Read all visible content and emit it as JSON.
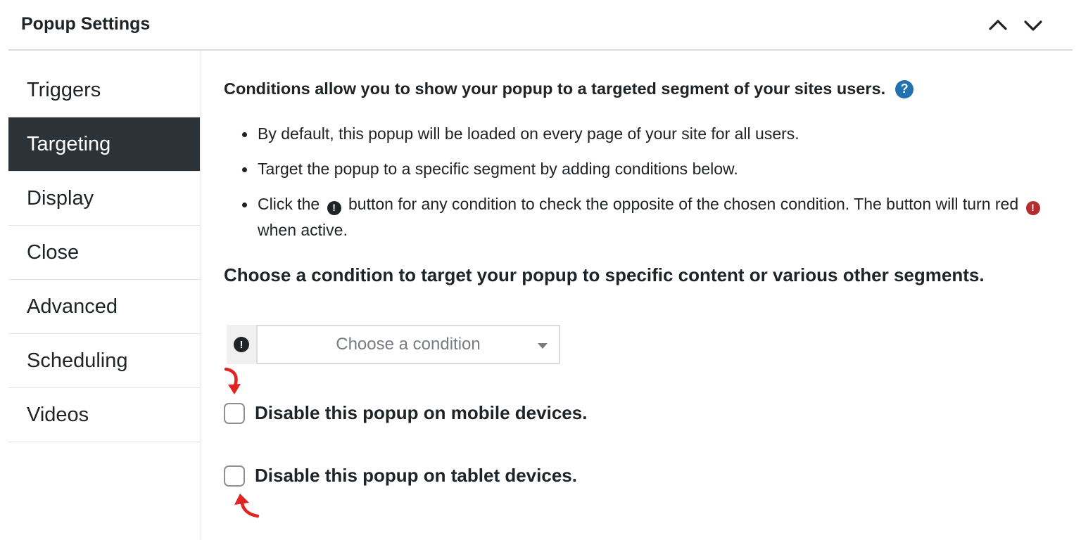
{
  "header": {
    "title": "Popup Settings",
    "up_icon": "chevron-up-icon",
    "down_icon": "chevron-down-icon"
  },
  "tabs": [
    {
      "label": "Triggers",
      "active": false
    },
    {
      "label": "Targeting",
      "active": true
    },
    {
      "label": "Display",
      "active": false
    },
    {
      "label": "Close",
      "active": false
    },
    {
      "label": "Advanced",
      "active": false
    },
    {
      "label": "Scheduling",
      "active": false
    },
    {
      "label": "Videos",
      "active": false
    }
  ],
  "content": {
    "intro": "Conditions allow you to show your popup to a targeted segment of your sites users.",
    "help_icon": "?",
    "bullets": [
      {
        "text": "By default, this popup will be loaded on every page of your site for all users."
      },
      {
        "text": "Target the popup to a specific segment by adding conditions below."
      },
      {
        "text_a": "Click the",
        "text_b": "button for any condition to check the opposite of the chosen condition. The button will turn red",
        "text_c": "when active."
      }
    ],
    "choose_heading": "Choose a condition to target your popup to specific content or various other segments.",
    "condition_select_placeholder": "Choose a condition",
    "exclamation_glyph": "!",
    "disable_mobile": "Disable this popup on mobile devices.",
    "disable_tablet": "Disable this popup on tablet devices."
  },
  "colors": {
    "active_tab_bg": "#2c3338",
    "help_blue": "#2271b1",
    "not_red": "#b32d2e",
    "arrow_red": "#e02424"
  }
}
